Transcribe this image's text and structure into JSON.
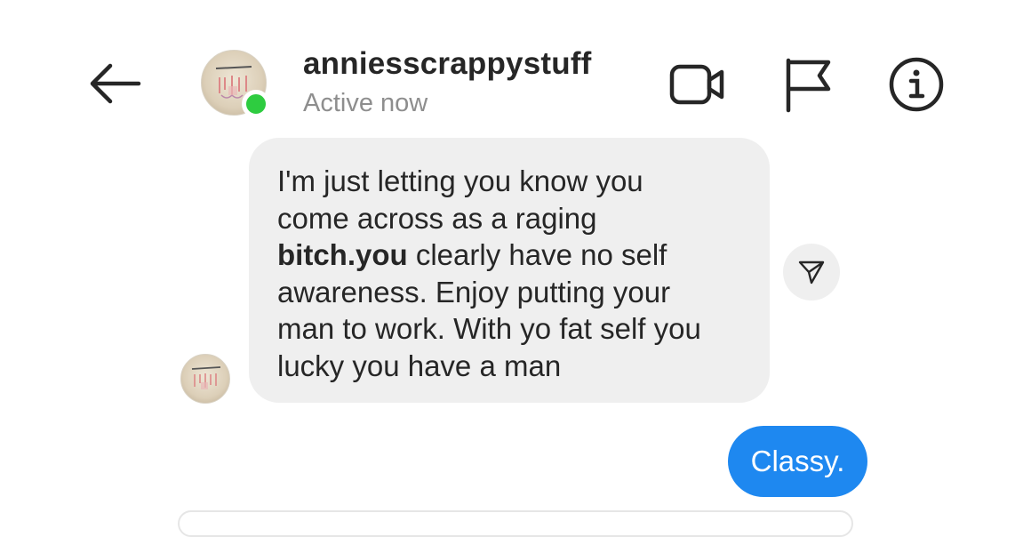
{
  "header": {
    "username": "anniesscrappystuff",
    "status": "Active now",
    "icons": {
      "back": "back-arrow-icon",
      "video": "video-camera-icon",
      "flag": "flag-icon",
      "info": "info-icon"
    },
    "online_color": "#2ecc40"
  },
  "conversation": {
    "incoming_message": {
      "lines": [
        {
          "text": "I'm just letting you know you"
        },
        {
          "text": "come across as a raging"
        },
        {
          "bold": "bitch.you",
          "text": " clearly have no self"
        },
        {
          "text": "awareness. Enjoy putting your"
        },
        {
          "text": "man to work. With yo fat self you"
        },
        {
          "text": "lucky you have a man"
        }
      ],
      "bubble_color": "#efefef",
      "share_icon": "send-paper-plane-icon"
    },
    "outgoing_message": {
      "text": "Classy.",
      "bubble_color": "#1e88f0"
    }
  }
}
